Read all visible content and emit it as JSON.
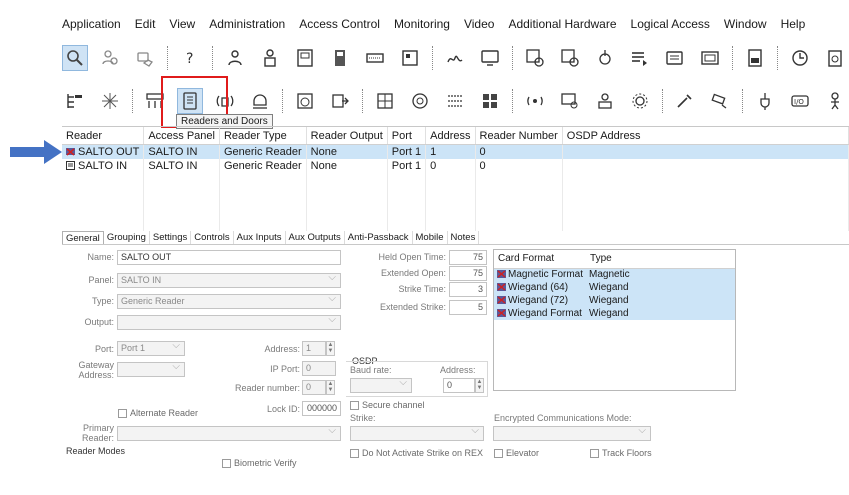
{
  "menu": [
    "Application",
    "Edit",
    "View",
    "Administration",
    "Access Control",
    "Monitoring",
    "Video",
    "Additional Hardware",
    "Logical Access",
    "Window",
    "Help"
  ],
  "toolbar1_icons": [
    "magnifier-icon",
    "users-group-icon",
    "badge-hand-icon",
    "help-icon",
    "person-key-icon",
    "person-card-icon",
    "card-reader-icon",
    "door-icon",
    "keypad-icon",
    "panel-icon",
    "signature-icon",
    "monitor-icon",
    "gears-doc-icon",
    "gears-doc-2-icon",
    "touch-icon",
    "list-arrow-icon",
    "screen-icon",
    "device-icon",
    "printer-icon",
    "clock-icon",
    "alarm-panel-icon"
  ],
  "toolbar2_icons": [
    "tree-icon",
    "sparkle-icon",
    "access-panel-icon",
    "readers-doors-icon",
    "wireless-icon",
    "intercom-icon",
    "timer-icon",
    "export-icon",
    "matrix-icon",
    "zone-icon",
    "keypad-grid-icon",
    "grid-icon",
    "audio-icon",
    "camera-search-icon",
    "badge-person-icon",
    "gear-icon",
    "tool-icon",
    "cctv-icon",
    "plug-icon",
    "io-icon",
    "person-icon"
  ],
  "tooltip": "Readers and Doors",
  "grid": {
    "columns": [
      "Reader",
      "Access Panel",
      "Reader Type",
      "Reader Output",
      "Port",
      "Address",
      "Reader Number",
      "OSDP Address"
    ],
    "rows": [
      {
        "reader": "SALTO OUT",
        "panel": "SALTO IN",
        "type": "Generic Reader",
        "output": "None",
        "port": "Port 1",
        "address": "1",
        "number": "0",
        "osdp": ""
      },
      {
        "reader": "SALTO IN",
        "panel": "SALTO IN",
        "type": "Generic Reader",
        "output": "None",
        "port": "Port 1",
        "address": "0",
        "number": "0",
        "osdp": ""
      }
    ]
  },
  "tabs": [
    "General",
    "Grouping",
    "Settings",
    "Controls",
    "Aux Inputs",
    "Aux Outputs",
    "Anti-Passback",
    "Mobile",
    "Notes"
  ],
  "form": {
    "name_label": "Name:",
    "name_value": "SALTO OUT",
    "panel_label": "Panel:",
    "panel_value": "SALTO IN",
    "type_label": "Type:",
    "type_value": "Generic Reader",
    "output_label": "Output:",
    "output_value": "",
    "port_label": "Port:",
    "port_value": "Port 1",
    "gateway_label": "Gateway Address:",
    "address_label": "Address:",
    "address_value": "1",
    "ipport_label": "IP Port:",
    "ipport_value": "0",
    "readernum_label": "Reader number:",
    "readernum_value": "0",
    "lockid_label": "Lock ID:",
    "lockid_value": "000000",
    "alternate_label": "Alternate Reader",
    "primary_label": "Primary Reader:",
    "reader_modes_label": "Reader Modes",
    "biometric_label": "Biometric Verify",
    "held_open_label": "Held Open Time:",
    "held_open_value": "75",
    "extended_open_label": "Extended Open:",
    "extended_open_value": "75",
    "strike_time_label": "Strike Time:",
    "strike_time_value": "3",
    "extended_strike_label": "Extended Strike:",
    "extended_strike_value": "5",
    "osdp_label": "OSDP",
    "baud_label": "Baud rate:",
    "osdp_address_label": "Address:",
    "osdp_address_value": "0",
    "secure_channel_label": "Secure channel",
    "strike_label": "Strike:",
    "no_strike_rex_label": "Do Not Activate Strike on REX",
    "encrypted_label": "Encrypted Communications Mode:",
    "elevator_label": "Elevator",
    "track_floors_label": "Track Floors"
  },
  "card_formats": {
    "columns": [
      "Card Format",
      "Type"
    ],
    "rows": [
      {
        "format": "Magnetic Format",
        "type": "Magnetic"
      },
      {
        "format": "Wiegand (64)",
        "type": "Wiegand"
      },
      {
        "format": "Wiegand (72)",
        "type": "Wiegand"
      },
      {
        "format": "Wiegand Format",
        "type": "Wiegand"
      }
    ]
  },
  "colors": {
    "selection": "#cce4f7",
    "highlight": "#e01b1b",
    "arrow": "#4472c4"
  }
}
